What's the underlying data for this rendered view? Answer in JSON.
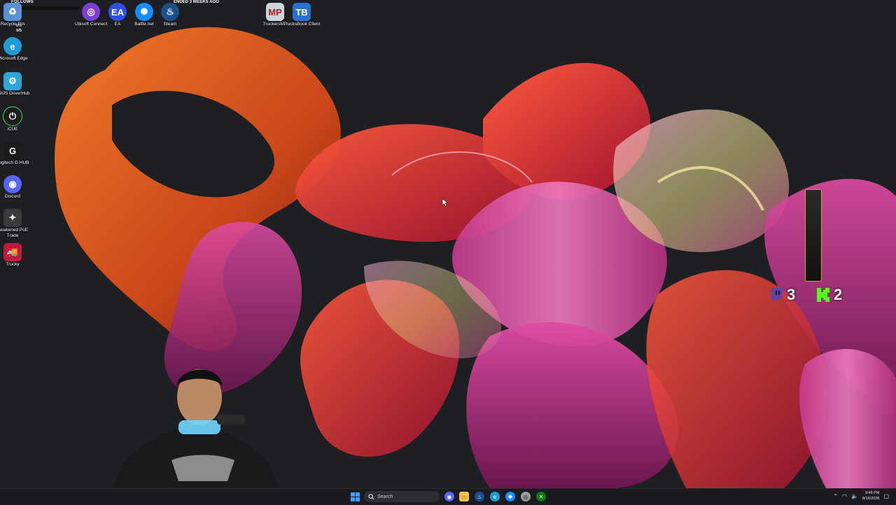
{
  "overlay": {
    "follows_label": "FOLLOWS",
    "ended_label": "ENDED 3 WEEKS AGO",
    "stats": [
      "0%",
      "0/5"
    ]
  },
  "desktop_icons": [
    {
      "label": "Recycle Bin",
      "icon": "recycle-bin-icon",
      "color": "#5b8fd6"
    },
    {
      "label": "Microsoft Edge",
      "icon": "edge-icon",
      "color": "#1f9bd6"
    },
    {
      "label": "ASUS DriverHub",
      "icon": "asus-driverhub-icon",
      "color": "#2fa6d9"
    },
    {
      "label": "iCUE",
      "icon": "icue-icon",
      "color": "#1c1c1c"
    },
    {
      "label": "Logitech G HUB",
      "icon": "logitech-ghub-icon",
      "color": "#1b1b1b"
    },
    {
      "label": "Discord",
      "icon": "discord-icon",
      "color": "#5865f2"
    },
    {
      "label": "Awakened PoE Trade",
      "icon": "awakened-poe-trade-icon",
      "color": "#3a3a3a"
    },
    {
      "label": "Trucky",
      "icon": "trucky-icon",
      "color": "#c2183c"
    }
  ],
  "top_icons": [
    {
      "label": "Ubisoft Connect",
      "icon": "ubisoft-connect-icon",
      "color": "#7b3fd6"
    },
    {
      "label": "EA",
      "icon": "ea-icon",
      "color": "#2f50e8"
    },
    {
      "label": "Battle.net",
      "icon": "battle-net-icon",
      "color": "#148eff"
    },
    {
      "label": "Steam",
      "icon": "steam-icon",
      "color": "#1b4f8a"
    },
    {
      "label": "TruckersMP",
      "icon": "truckersmp-icon",
      "color": "#cfd3da"
    },
    {
      "label": "TrucksBook Client",
      "icon": "trucksbook-client-icon",
      "color": "#2b6fd0"
    }
  ],
  "viewers": [
    {
      "platform": "twitch-icon",
      "count": "3",
      "color": "#6441a5"
    },
    {
      "platform": "kick-icon",
      "count": "2",
      "color": "#53fc18"
    }
  ],
  "taskbar": {
    "search_placeholder": "Search",
    "pinned": [
      {
        "icon": "discord-icon",
        "color": "#5865f2"
      },
      {
        "icon": "file-explorer-icon",
        "color": "#f2c14e"
      },
      {
        "icon": "steam-icon",
        "color": "#1b4f8a"
      },
      {
        "icon": "edge-icon",
        "color": "#1f9bd6"
      },
      {
        "icon": "battle-net-icon",
        "color": "#148eff"
      },
      {
        "icon": "obs-icon",
        "color": "#9a9a9a"
      },
      {
        "icon": "xbox-icon",
        "color": "#107c10"
      }
    ],
    "time": "9:46 PM",
    "date": "8/16/2026"
  },
  "colors": {
    "desktop_bg": "#1e1f23",
    "taskbar_bg": "#1a1b1f"
  }
}
